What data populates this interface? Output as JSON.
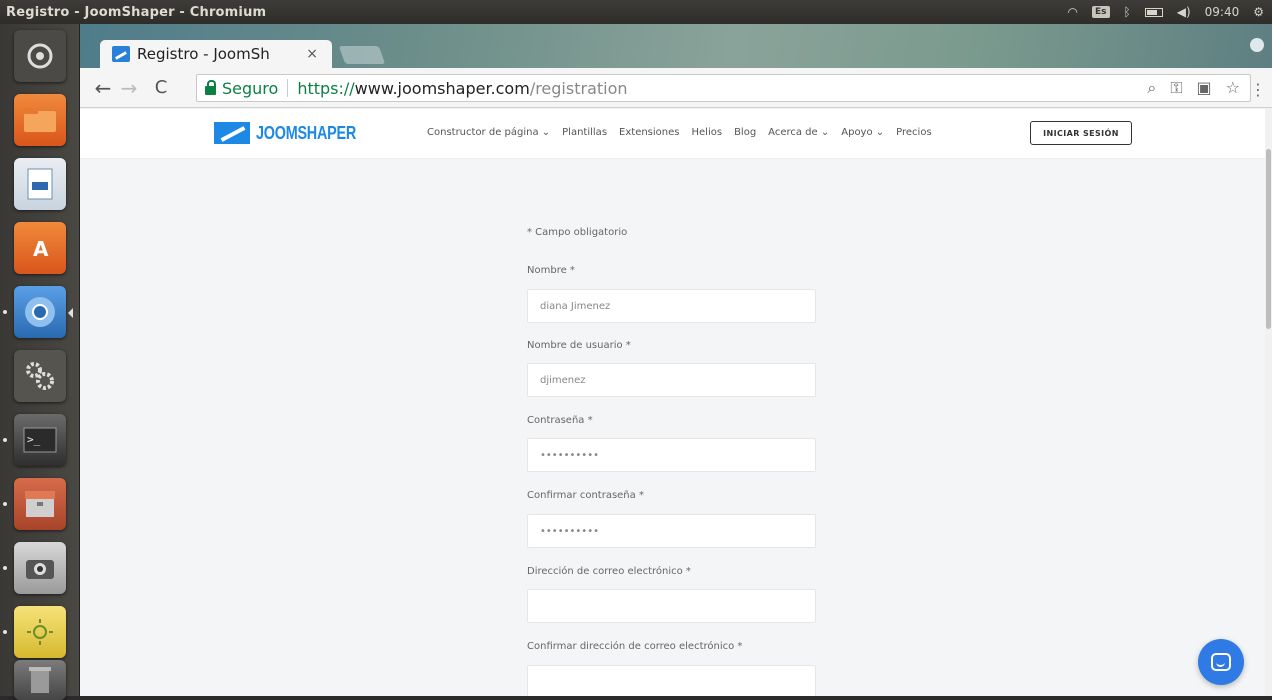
{
  "system": {
    "window_title": "Registro - JoomShaper - Chromium",
    "keyboard_layout": "Es",
    "clock": "09:40"
  },
  "launcher": {
    "items": [
      {
        "name": "dash-icon",
        "color": "#5a5955"
      },
      {
        "name": "files-icon",
        "color": "#e8722a"
      },
      {
        "name": "writer-icon",
        "color": "#3b7fc0"
      },
      {
        "name": "software-center-icon",
        "color": "#e36b2a"
      },
      {
        "name": "chromium-icon",
        "color": "#3f82c8"
      },
      {
        "name": "settings-icon",
        "color": "#5e5d59"
      },
      {
        "name": "terminal-icon",
        "color": "#3b3b3b"
      },
      {
        "name": "archive-icon",
        "color": "#c75d3b"
      },
      {
        "name": "camera-icon",
        "color": "#8a8a8a"
      },
      {
        "name": "brightness-icon",
        "color": "#e8d34a"
      },
      {
        "name": "trash-icon",
        "color": "#6c6c6c"
      }
    ]
  },
  "browser": {
    "tab_title": "Registro - JoomSh",
    "tab_close": "×",
    "security_label": "Seguro",
    "url_scheme": "https://",
    "url_host": "www.joomshaper.com",
    "url_path": "/registration"
  },
  "site": {
    "logo_text": "JOOMSHAPER",
    "nav": [
      "Constructor de página ⌄",
      "Plantillas",
      "Extensiones",
      "Helios",
      "Blog",
      "Acerca de ⌄",
      "Apoyo ⌄",
      "Precios"
    ],
    "login_label": "INICIAR SESIÓN"
  },
  "form": {
    "required_note": "* Campo obligatorio",
    "fields": [
      {
        "label": "Nombre *",
        "value": "diana Jimenez"
      },
      {
        "label": "Nombre de usuario *",
        "value": "djimenez"
      },
      {
        "label": "Contraseña *",
        "value": "••••••••••"
      },
      {
        "label": "Confirmar contraseña *",
        "value": "••••••••••"
      },
      {
        "label": "Dirección de correo electrónico *",
        "value": ""
      },
      {
        "label": "Confirmar dirección de correo electrónico *",
        "value": ""
      }
    ]
  }
}
